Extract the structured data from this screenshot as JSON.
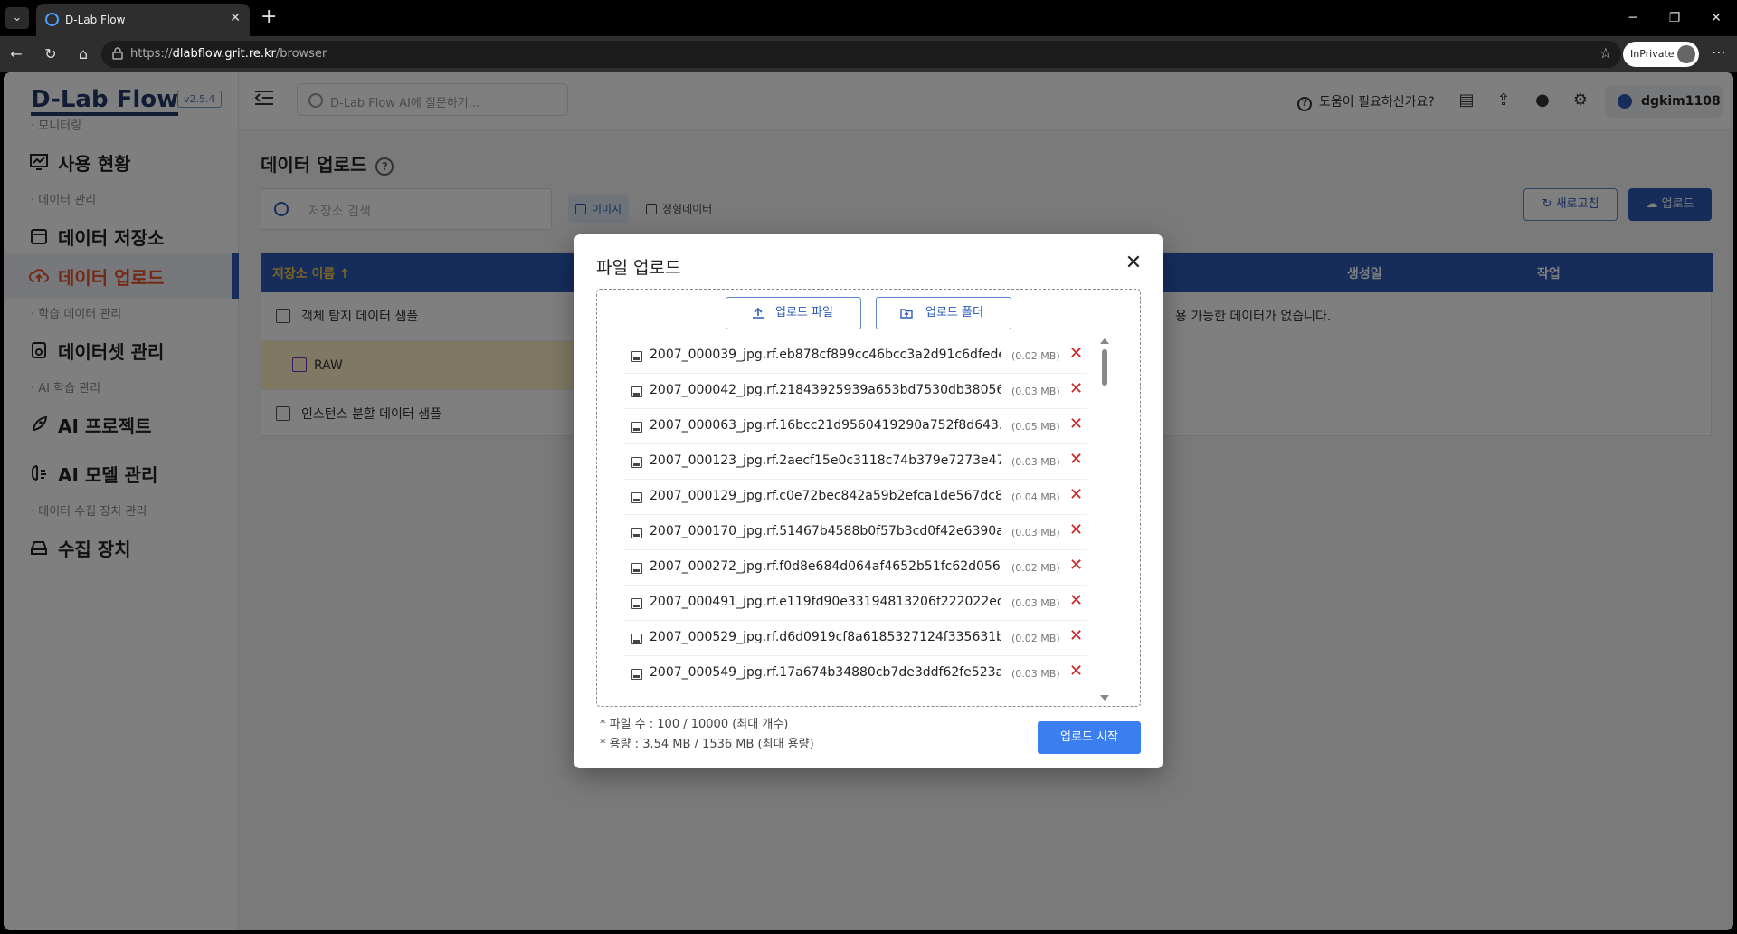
{
  "browser": {
    "tab_title": "D-Lab Flow",
    "url_host": "dlabflow.grit.re.kr",
    "url_prefix": "https://",
    "url_path": "/browser",
    "inprivate_label": "InPrivate"
  },
  "app": {
    "logo": "D-Lab Flow",
    "version": "v2.5.4",
    "ai_placeholder": "D-Lab Flow AI에 질문하기...",
    "help_label": "도움이 필요하신가요?",
    "username": "dgkim1108"
  },
  "sidebar": {
    "sections": [
      {
        "label": "· 모니터링"
      },
      {
        "label": "· 데이터 관리"
      },
      {
        "label": "· 학습 데이터 관리"
      },
      {
        "label": "· AI 학습 관리"
      },
      {
        "label": "· 데이터 수집 장치 관리"
      }
    ],
    "items": [
      {
        "label": "사용 현황"
      },
      {
        "label": "데이터 저장소"
      },
      {
        "label": "데이터 업로드"
      },
      {
        "label": "데이터셋 관리"
      },
      {
        "label": "AI 프로젝트"
      },
      {
        "label": "AI 모델 관리"
      },
      {
        "label": "수집 장치"
      }
    ]
  },
  "page": {
    "title": "데이터 업로드",
    "search_placeholder": "저장소 검색",
    "type_tabs": [
      {
        "label": "이미지"
      },
      {
        "label": "정형데이터"
      }
    ],
    "refresh_label": "새로고침",
    "upload_label": "업로드",
    "table": {
      "col_name": "저장소 이름 ↑",
      "col_created": "생성일",
      "col_action": "작업",
      "empty_message": "용 가능한 데이터가 없습니다."
    },
    "tree": [
      {
        "label": "객체 탐지 데이터 샘플"
      },
      {
        "label": "RAW"
      },
      {
        "label": "인스턴스 분할 데이터 샘플"
      }
    ]
  },
  "modal": {
    "title": "파일 업로드",
    "upload_file_label": "업로드 파일",
    "upload_folder_label": "업로드 폴더",
    "files": [
      {
        "name": "2007_000039_jpg.rf.eb878cf899cc46bcc3a2d91c6dfede...",
        "size": "(0.02 MB)"
      },
      {
        "name": "2007_000042_jpg.rf.21843925939a653bd7530db38056...",
        "size": "(0.03 MB)"
      },
      {
        "name": "2007_000063_jpg.rf.16bcc21d9560419290a752f8d643...",
        "size": "(0.05 MB)"
      },
      {
        "name": "2007_000123_jpg.rf.2aecf15e0c3118c74b379e7273e47...",
        "size": "(0.03 MB)"
      },
      {
        "name": "2007_000129_jpg.rf.c0e72bec842a59b2efca1de567dc8...",
        "size": "(0.04 MB)"
      },
      {
        "name": "2007_000170_jpg.rf.51467b4588b0f57b3cd0f42e6390a...",
        "size": "(0.03 MB)"
      },
      {
        "name": "2007_000272_jpg.rf.f0d8e684d064af4652b51fc62d056...",
        "size": "(0.02 MB)"
      },
      {
        "name": "2007_000491_jpg.rf.e119fd90e33194813206f222022ed...",
        "size": "(0.03 MB)"
      },
      {
        "name": "2007_000529_jpg.rf.d6d0919cf8a6185327124f335631b...",
        "size": "(0.02 MB)"
      },
      {
        "name": "2007_000549_jpg.rf.17a674b34880cb7de3ddf62fe523af...",
        "size": "(0.03 MB)"
      }
    ],
    "remove_glyph": "✕",
    "file_count_text": "* 파일 수 : 100 / 10000 (최대 개수)",
    "capacity_text": "* 용량 : 3.54 MB / 1536 MB (최대 용량)",
    "start_label": "업로드 시작"
  }
}
